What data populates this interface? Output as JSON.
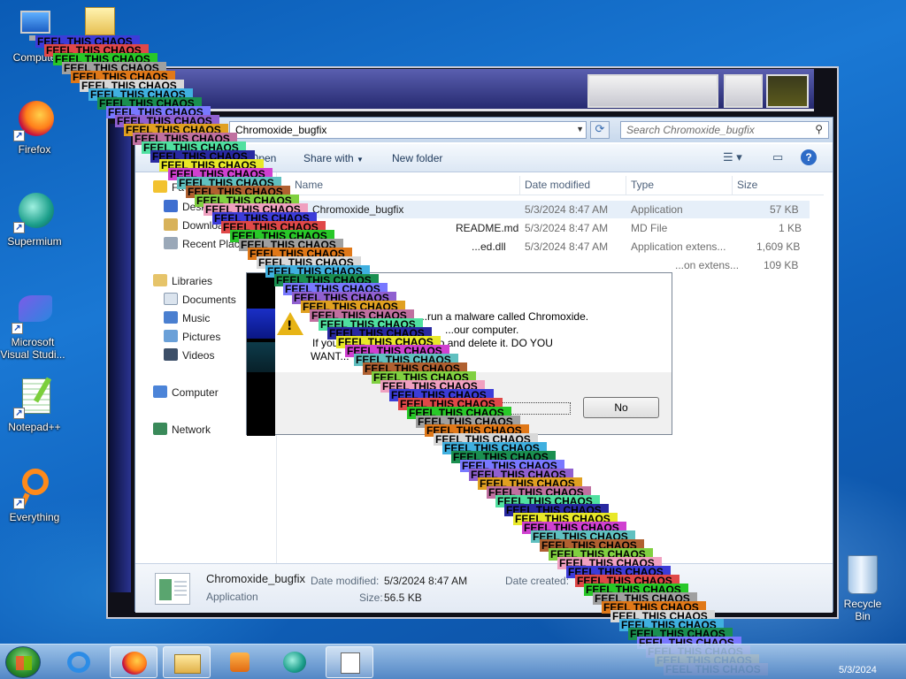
{
  "desktop": {
    "icons": [
      {
        "label": "Computer",
        "icon": "computer-icon"
      },
      {
        "label": "Firefox",
        "icon": "firefox-icon"
      },
      {
        "label": "Supermium",
        "icon": "supermium-icon"
      },
      {
        "label": "Microsoft Visual Studi...",
        "icon": "visual-studio-icon"
      },
      {
        "label": "Notepad++",
        "icon": "notepadpp-icon"
      },
      {
        "label": "Everything",
        "icon": "everything-icon"
      }
    ],
    "recycle_bin": "Recycle Bin"
  },
  "explorer": {
    "address": "Chromoxide_bugfix",
    "search_placeholder": "Search Chromoxide_bugfix",
    "toolbar": {
      "open": "Open",
      "share_with": "Share with",
      "new_folder": "New folder"
    },
    "nav": {
      "favorites": [
        "Favorites",
        "Desktop",
        "Downloads",
        "Recent Places"
      ],
      "libraries": "Libraries",
      "library_items": [
        "Documents",
        "Music",
        "Pictures",
        "Videos"
      ],
      "computer": "Computer",
      "network": "Network"
    },
    "columns": [
      "Name",
      "Date modified",
      "Type",
      "Size"
    ],
    "files": [
      {
        "name": "Chromoxide_bugfix",
        "date": "5/3/2024 8:47 AM",
        "type": "Application",
        "size": "57 KB"
      },
      {
        "name": "README.md",
        "date": "5/3/2024 8:47 AM",
        "type": "MD File",
        "size": "1 KB"
      },
      {
        "name": "...ed.dll",
        "date": "5/3/2024 8:47 AM",
        "type": "Application extens...",
        "size": "1,609 KB"
      },
      {
        "name": "",
        "date": "",
        "type": "...on extens...",
        "size": "109 KB"
      }
    ],
    "details": {
      "name": "Chromoxide_bugfix",
      "kind": "Application",
      "date_modified_label": "Date modified:",
      "date_modified": "5/3/2024 8:47 AM",
      "size_label": "Size:",
      "size": "56.5 KB",
      "date_created_label": "Date created:"
    }
  },
  "dialog": {
    "line1": "...run a malware called Chromoxide.",
    "line2": "...our computer.",
    "line3": "If you... ...is file do, press no and delete it. DO YOU",
    "line4": "WANT...",
    "no_button": "No"
  },
  "chaos_text": "FEEL THIS CHAOS",
  "chaos_colors": [
    "#3c3cd8",
    "#e04848",
    "#28c828",
    "#a0a0a0",
    "#e07818",
    "#d8d8d8",
    "#40b0e0",
    "#1a8f50",
    "#7878ff",
    "#9060d0",
    "#e0a020",
    "#c070a0",
    "#50e0a0",
    "#2828a0",
    "#e8e828",
    "#d040d0",
    "#60c0c0",
    "#b06030",
    "#80d040",
    "#f0a0c0"
  ],
  "taskbar": {
    "buttons": [
      "start-button",
      "internet-explorer-icon",
      "firefox-icon",
      "explorer-icon",
      "media-player-icon",
      "supermium-icon",
      "dialog-app-icon"
    ],
    "clock": "5/3/2024"
  }
}
